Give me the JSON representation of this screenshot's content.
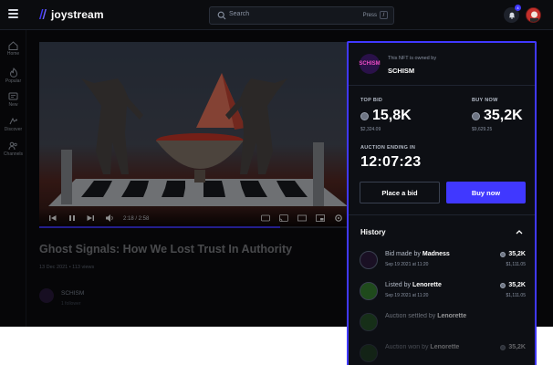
{
  "app": {
    "logo_text": "joystream",
    "search_placeholder": "Search",
    "search_hint_press": "Press",
    "search_hint_key": "/",
    "notification_count": "4",
    "accent": "#4038ff"
  },
  "sidebar": {
    "items": [
      {
        "label": "Home",
        "icon": "home-icon"
      },
      {
        "label": "Popular",
        "icon": "flame-icon"
      },
      {
        "label": "New",
        "icon": "new-icon"
      },
      {
        "label": "Discover",
        "icon": "discover-icon"
      },
      {
        "label": "Channels",
        "icon": "channels-icon"
      }
    ]
  },
  "video": {
    "time": "2:18 / 2:58",
    "progress": 0.78,
    "title": "Ghost Signals: How We Lost Trust In Authority",
    "meta": "13 Dec 2021 • 113 views",
    "channel_name": "SCHISM",
    "channel_sub": "1 follower"
  },
  "nft": {
    "owned_by_label": "This NFT is owned by",
    "owner_avatar_text": "SCH ISM",
    "owner_name": "SCHISM",
    "top_bid_label": "TOP BID",
    "top_bid_value": "15,8K",
    "top_bid_usd": "$2,324.09",
    "buy_now_label": "BUY NOW",
    "buy_now_value": "35,2K",
    "buy_now_usd": "$9,629.25",
    "auction_label": "AUCTION ENDING IN",
    "auction_timer": "12:07:23",
    "place_bid": "Place a bid",
    "buy_now": "Buy now",
    "history_title": "History",
    "history": [
      {
        "action": "Bid made by",
        "who": "Madness",
        "date": "Sep 19 2021 at 11:20",
        "amount": "35,2K",
        "usd": "$1,111.05",
        "avatar_color": "#1a1024"
      },
      {
        "action": "Listed by",
        "who": "Lenorette",
        "date": "Sep 19 2021 at 11:20",
        "amount": "35,2K",
        "usd": "$1,111.05",
        "avatar_color": "#1f4a1c"
      },
      {
        "action": "Auction settled by",
        "who": "Lenorette",
        "date": "",
        "amount": "",
        "usd": "",
        "avatar_color": "#1f4a1c"
      },
      {
        "action": "Auction won by",
        "who": "Lenorette",
        "date": "",
        "amount": "35,2K",
        "usd": "",
        "avatar_color": "#1f4a1c"
      }
    ]
  }
}
